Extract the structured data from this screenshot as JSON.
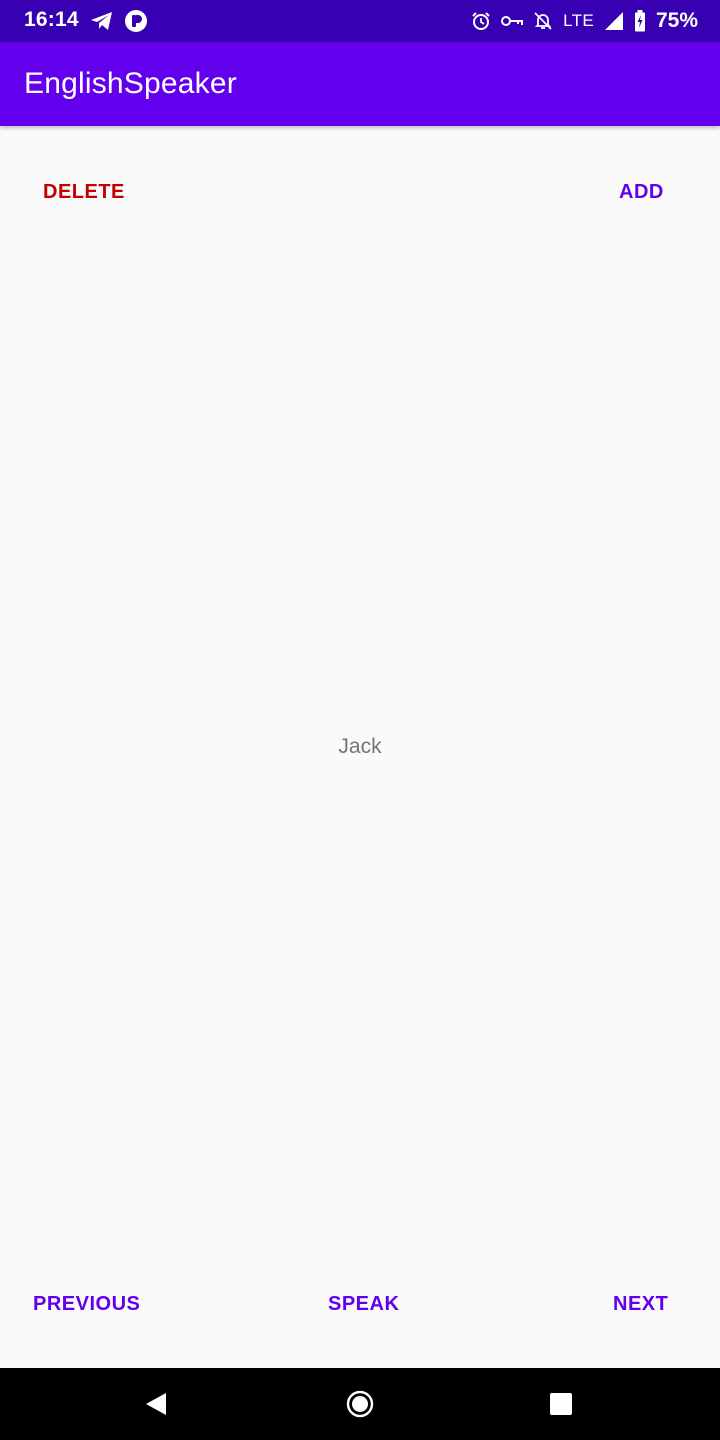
{
  "status_bar": {
    "time": "16:14",
    "network": "LTE",
    "battery": "75%",
    "left_icons": [
      "telegram-icon",
      "app-notification-icon"
    ],
    "right_icons": [
      "alarm-icon",
      "vpn-key-icon",
      "notifications-off-icon",
      "signal-icon",
      "battery-icon"
    ]
  },
  "app_bar": {
    "title": "EnglishSpeaker"
  },
  "actions": {
    "delete_label": "DELETE",
    "add_label": "ADD"
  },
  "main": {
    "word": "Jack"
  },
  "controls": {
    "previous_label": "PREVIOUS",
    "speak_label": "SPEAK",
    "next_label": "NEXT"
  },
  "nav_bar": {
    "icons": [
      "back-icon",
      "home-icon",
      "recents-icon"
    ]
  },
  "colors": {
    "status_bar": "#3700b3",
    "app_bar": "#6200ee",
    "accent": "#6200ee",
    "delete": "#c30000",
    "background": "#fafafa",
    "word_text": "#757575"
  }
}
